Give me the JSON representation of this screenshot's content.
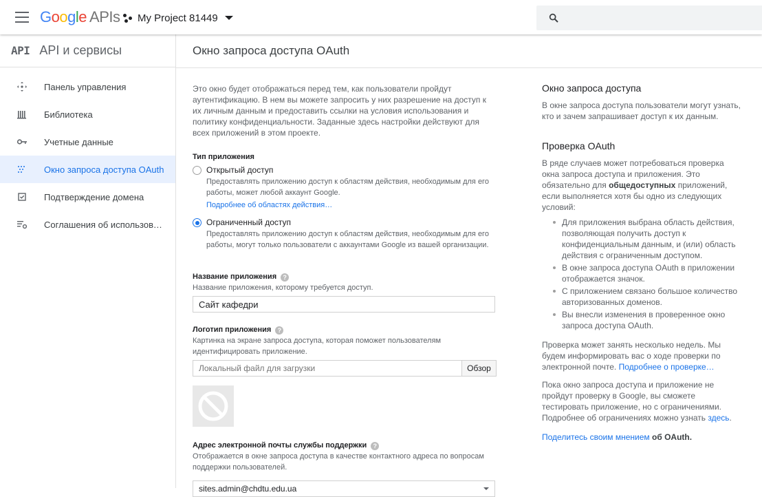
{
  "topbar": {
    "logo_letters": [
      "G",
      "o",
      "o",
      "g",
      "l",
      "e"
    ],
    "logo_suffix": "APIs",
    "project_name": "My Project 81449"
  },
  "sidebar": {
    "badge": "API",
    "title": "API и сервисы",
    "items": [
      {
        "label": "Панель управления",
        "icon": "dashboard-icon"
      },
      {
        "label": "Библиотека",
        "icon": "library-icon"
      },
      {
        "label": "Учетные данные",
        "icon": "key-icon"
      },
      {
        "label": "Окно запроса доступа OAuth",
        "icon": "consent-icon",
        "active": true
      },
      {
        "label": "Подтверждение домена",
        "icon": "domain-check-icon"
      },
      {
        "label": "Соглашения об использовании",
        "icon": "settings-list-icon"
      }
    ]
  },
  "main": {
    "title": "Окно запроса доступа OAuth",
    "intro": "Это окно будет отображаться перед тем, как пользователи пройдут аутентификацию. В нем вы можете запросить у них разрешение на доступ к их личным данным и предоставить ссылки на условия использования и политику конфиденциальности. Заданные здесь настройки действуют для всех приложений в этом проекте.",
    "app_type": {
      "label": "Тип приложения",
      "public": {
        "title": "Открытый доступ",
        "desc": "Предоставлять приложению доступ к областям действия, необходимым для его работы, может любой аккаунт Google.",
        "link": "Подробнее об областях действия…"
      },
      "internal": {
        "title": "Ограниченный доступ",
        "desc": "Предоставлять приложению доступ к областям действия, необходимым для его работы, могут только пользователи с аккаунтами Google из вашей организации."
      }
    },
    "app_name": {
      "label": "Название приложения",
      "hint": "Название приложения, которому требуется доступ.",
      "value": "Сайт кафедри"
    },
    "app_logo": {
      "label": "Логотип приложения",
      "hint": "Картинка на экране запроса доступа, которая поможет пользователям идентифицировать приложение.",
      "placeholder": "Локальный файл для загрузки",
      "browse": "Обзор"
    },
    "support_email": {
      "label": "Адрес электронной почты службы поддержки",
      "hint": "Отображается в окне запроса доступа в качестве контактного адреса по вопросам поддержки пользователей.",
      "value": "sites.admin@chdtu.edu.ua"
    },
    "help_glyph": "?"
  },
  "aside": {
    "h1": "Окно запроса доступа",
    "p1": "В окне запроса доступа пользователи могут узнать, кто и зачем запрашивает доступ к их данным.",
    "h2": "Проверка OAuth",
    "p2_a": "В ряде случаев может потребоваться проверка окна запроса доступа и приложения. Это обязательно для",
    "p2_bold": "общедоступных",
    "p2_b": "приложений, если выполняется хотя бы одно из следующих условий:",
    "bullets": [
      "Для приложения выбрана область действия, позволяющая получить доступ к конфиденциальным данным, и (или) область действия с ограниченным доступом.",
      "В окне запроса доступа OAuth в приложении отображается значок.",
      "С приложением связано большое количество авторизованных доменов.",
      "Вы внесли изменения в проверенное окно запроса доступа OAuth."
    ],
    "p3": "Проверка может занять несколько недель. Мы будем информировать вас о ходе проверки по электронной почте.",
    "p3_link": "Подробнее о проверке…",
    "p4": "Пока окно запроса доступа и приложение не пройдут проверку в Google, вы сможете тестировать приложение, но с ограничениями. Подробнее об ограничениях можно узнать",
    "p4_link": "здесь",
    "p5_link": "Поделитесь своим мнением",
    "p5_rest": "об OAuth."
  }
}
